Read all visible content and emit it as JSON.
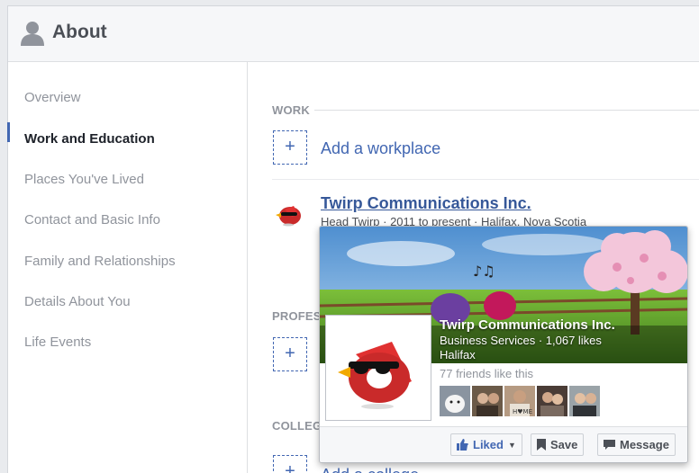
{
  "header": {
    "title": "About"
  },
  "sidebar": {
    "items": [
      {
        "label": "Overview",
        "active": false
      },
      {
        "label": "Work and Education",
        "active": true
      },
      {
        "label": "Places You've Lived",
        "active": false
      },
      {
        "label": "Contact and Basic Info",
        "active": false
      },
      {
        "label": "Family and Relationships",
        "active": false
      },
      {
        "label": "Details About You",
        "active": false
      },
      {
        "label": "Life Events",
        "active": false
      }
    ]
  },
  "main": {
    "work": {
      "label": "WORK",
      "add_label": "Add a workplace",
      "entry": {
        "title": "Twirp Communications Inc.",
        "subtitle": "Head Twirp · 2011 to present · Halifax, Nova Scotia"
      }
    },
    "professional": {
      "label": "PROFES"
    },
    "college": {
      "label": "COLLEG",
      "add_label": "Add a college"
    }
  },
  "hovercard": {
    "name": "Twirp Communications Inc.",
    "category": "Business Services · 1,067 likes",
    "city": "Halifax",
    "friends_text": "77 friends like this",
    "buttons": {
      "liked": "Liked",
      "save": "Save",
      "message": "Message"
    }
  },
  "colors": {
    "accent": "#4267b2",
    "link": "#365899",
    "muted": "#90949c"
  }
}
